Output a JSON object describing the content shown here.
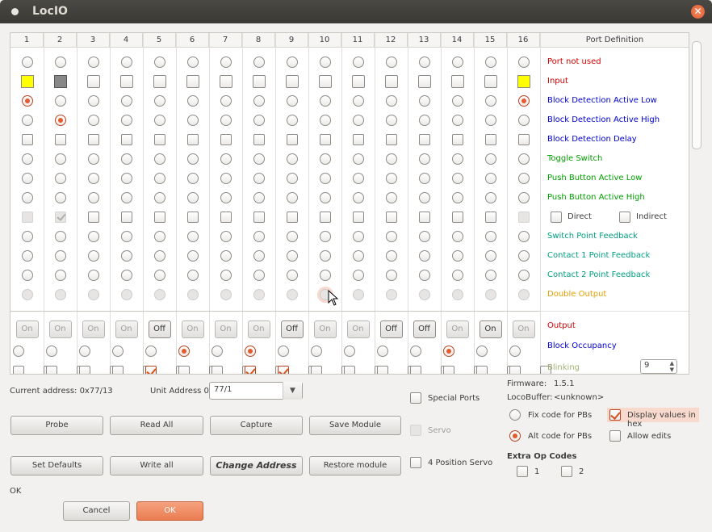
{
  "window": {
    "title": "LocIO"
  },
  "grid": {
    "columns": [
      "1",
      "2",
      "3",
      "4",
      "5",
      "6",
      "7",
      "8",
      "9",
      "10",
      "11",
      "12",
      "13",
      "14",
      "15",
      "16"
    ],
    "port_definition_header": "Port Definition",
    "definitions": [
      {
        "label": "Port not used",
        "color": "#d40000"
      },
      {
        "label": "Input",
        "color": "#d40000"
      },
      {
        "label": "Block Detection Active Low",
        "color": "#0000d4"
      },
      {
        "label": "Block Detection Active High",
        "color": "#0000d4"
      },
      {
        "label": "Block Detection Delay",
        "color": "#0000d4"
      },
      {
        "label": "Toggle Switch",
        "color": "#00a000"
      },
      {
        "label": "Push Button Active Low",
        "color": "#00a000"
      },
      {
        "label": "Push Button Active High",
        "color": "#00a000"
      },
      {
        "label": "",
        "color": "#333"
      },
      {
        "label": "Switch Point Feedback",
        "color": "#00a080"
      },
      {
        "label": "Contact 1 Point Feedback",
        "color": "#00a080"
      },
      {
        "label": "Contact 2 Point Feedback",
        "color": "#00a080"
      },
      {
        "label": "Double Output",
        "color": "#e8a000"
      }
    ],
    "direct_label": "Direct",
    "indirect_label": "Indirect",
    "output_label": "Output",
    "output_color": "#d40000",
    "block_occupancy_label": "Block Occupancy",
    "block_occupancy_color": "#0000d4",
    "blinking_label": "Blinking",
    "blinking_value": "9",
    "output_buttons": [
      "On",
      "On",
      "On",
      "On",
      "Off",
      "On",
      "On",
      "On",
      "Off",
      "On",
      "On",
      "Off",
      "Off",
      "On",
      "On",
      "On"
    ],
    "output_active": [
      false,
      false,
      false,
      false,
      true,
      false,
      false,
      false,
      true,
      false,
      false,
      true,
      true,
      false,
      true,
      false
    ]
  },
  "info": {
    "current_address": "Current address: 0x77/13",
    "unit_address_label": "Unit Address 0x",
    "unit_address_value": "77/1",
    "firmware_label": "Firmware:",
    "firmware_value": "1.5.1",
    "locobuffer_label": "LocoBuffer:",
    "locobuffer_value": "<unknown>"
  },
  "buttons": {
    "probe": "Probe",
    "read_all": "Read All",
    "capture": "Capture",
    "save_module": "Save Module",
    "set_defaults": "Set Defaults",
    "write_all": "Write all",
    "change_address": "Change Address",
    "restore_module": "Restore module",
    "cancel": "Cancel",
    "ok": "OK"
  },
  "options": {
    "special_ports": "Special Ports",
    "servo": "Servo",
    "four_position_servo": "4 Position Servo",
    "fix_code": "Fix code for PBs",
    "alt_code": "Alt code for PBs",
    "display_hex": "Display values in hex",
    "allow_edits": "Allow edits",
    "extra_op_codes": "Extra Op Codes",
    "op1": "1",
    "op2": "2"
  },
  "status": {
    "text": "OK"
  }
}
